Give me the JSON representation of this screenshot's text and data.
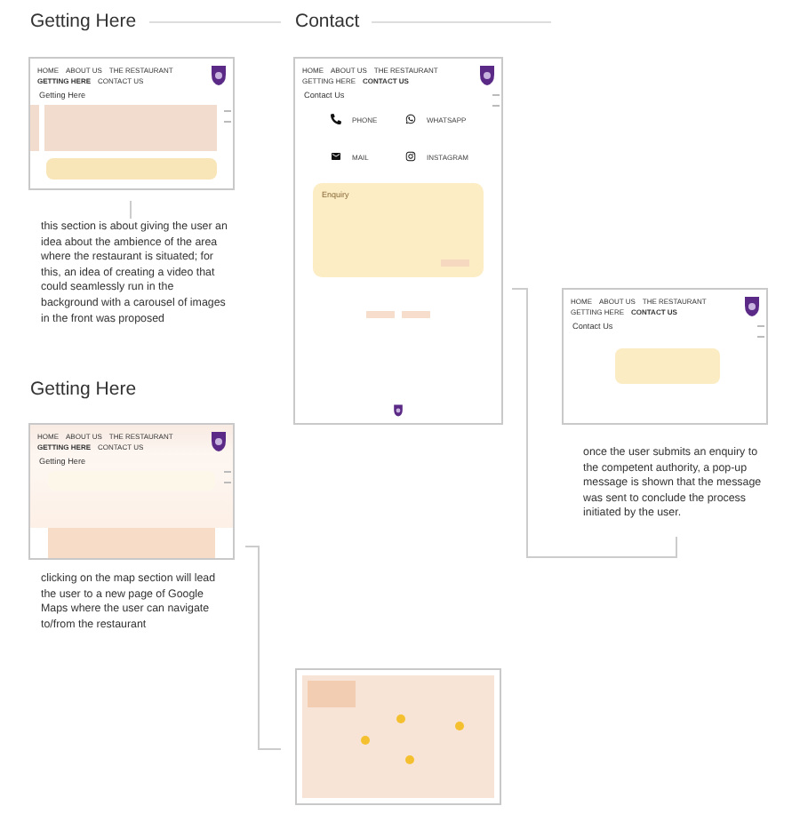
{
  "headings": [
    {
      "text": "Getting Here"
    },
    {
      "text": "Contact"
    },
    {
      "text": "Getting Here"
    }
  ],
  "screens": [
    {
      "kind": "video",
      "nav": [
        {
          "label": "HOME",
          "selected": false
        },
        {
          "label": "ABOUT US",
          "selected": false
        },
        {
          "label": "THE RESTAURANT",
          "selected": false
        },
        {
          "label": "GETTING HERE",
          "selected": true
        },
        {
          "label": "CONTACT US",
          "selected": false
        }
      ],
      "page_title": "Getting Here"
    },
    {
      "kind": "contact",
      "nav": [
        {
          "label": "HOME",
          "selected": false
        },
        {
          "label": "ABOUT US",
          "selected": false
        },
        {
          "label": "THE RESTAURANT",
          "selected": false
        },
        {
          "label": "GETTING HERE",
          "selected": false
        },
        {
          "label": "CONTACT US",
          "selected": true
        }
      ],
      "page_title": "Contact Us",
      "contacts": [
        {
          "label": "PHONE"
        },
        {
          "label": "WHATSAPP"
        },
        {
          "label": "MAIL"
        },
        {
          "label": "INSTAGRAM"
        }
      ],
      "enquiry": {
        "placeholder": "Enquiry"
      }
    },
    {
      "kind": "popup",
      "nav": [
        {
          "label": "HOME",
          "selected": false
        },
        {
          "label": "ABOUT US",
          "selected": false
        },
        {
          "label": "THE RESTAURANT",
          "selected": false
        },
        {
          "label": "GETTING HERE",
          "selected": false
        },
        {
          "label": "CONTACT US",
          "selected": true
        }
      ],
      "page_title": "Contact Us"
    },
    {
      "kind": "map_preview",
      "nav": [
        {
          "label": "HOME",
          "selected": false
        },
        {
          "label": "ABOUT US",
          "selected": false
        },
        {
          "label": "THE RESTAURANT",
          "selected": false
        },
        {
          "label": "GETTING HERE",
          "selected": true
        },
        {
          "label": "CONTACT US",
          "selected": false
        }
      ],
      "page_title": "Getting Here"
    },
    {
      "kind": "map"
    }
  ],
  "notes": [
    {
      "text": "this section is about giving the user an idea about the ambience of the area where the restaurant is situated; for this, an idea of creating a video that could seamlessly run in the background with a carousel of images in the front was proposed"
    },
    {
      "text": "once the user submits an enquiry to the competent authority, a pop-up message is shown that the message was sent to conclude the process initiated by the user."
    },
    {
      "text": "clicking on the map section will lead the user to a new page of Google Maps where the user can navigate to/from the restaurant"
    }
  ]
}
